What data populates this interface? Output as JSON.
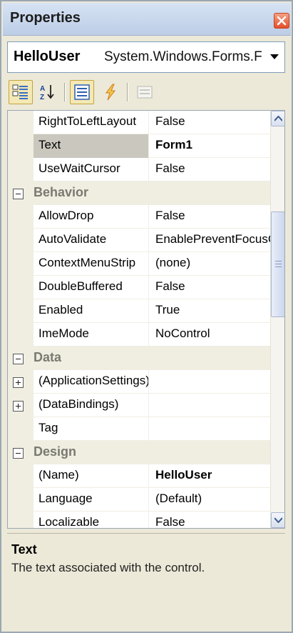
{
  "window": {
    "title": "Properties",
    "close_icon": "close-icon"
  },
  "selector": {
    "object_name": "HelloUser",
    "object_type": "System.Windows.Forms.Form"
  },
  "toolbar": {
    "buttons": [
      {
        "icon": "categorized-icon",
        "pressed": true
      },
      {
        "icon": "alphabetical-sort-icon",
        "pressed": false
      },
      {
        "icon": "properties-icon",
        "pressed": true
      },
      {
        "icon": "events-lightning-icon",
        "pressed": false
      },
      {
        "icon": "property-pages-icon",
        "pressed": false,
        "disabled": true
      }
    ]
  },
  "grid": {
    "rows": [
      {
        "kind": "prop",
        "name": "RightToLeftLayout",
        "value": "False"
      },
      {
        "kind": "prop",
        "name": "Text",
        "value": "Form1",
        "bold": true,
        "selected": true
      },
      {
        "kind": "prop",
        "name": "UseWaitCursor",
        "value": "False"
      },
      {
        "kind": "cat",
        "name": "Behavior",
        "expander": "minus"
      },
      {
        "kind": "prop",
        "name": "AllowDrop",
        "value": "False"
      },
      {
        "kind": "prop",
        "name": "AutoValidate",
        "value": "EnablePreventFocusChange"
      },
      {
        "kind": "prop",
        "name": "ContextMenuStrip",
        "value": "(none)"
      },
      {
        "kind": "prop",
        "name": "DoubleBuffered",
        "value": "False"
      },
      {
        "kind": "prop",
        "name": "Enabled",
        "value": "True"
      },
      {
        "kind": "prop",
        "name": "ImeMode",
        "value": "NoControl"
      },
      {
        "kind": "cat",
        "name": "Data",
        "expander": "minus"
      },
      {
        "kind": "prop",
        "name": "(ApplicationSettings)",
        "value": "",
        "expander": "plus"
      },
      {
        "kind": "prop",
        "name": "(DataBindings)",
        "value": "",
        "expander": "plus"
      },
      {
        "kind": "prop",
        "name": "Tag",
        "value": ""
      },
      {
        "kind": "cat",
        "name": "Design",
        "expander": "minus"
      },
      {
        "kind": "prop",
        "name": "(Name)",
        "value": "HelloUser",
        "bold": true
      },
      {
        "kind": "prop",
        "name": "Language",
        "value": "(Default)"
      },
      {
        "kind": "prop",
        "name": "Localizable",
        "value": "False"
      }
    ]
  },
  "description": {
    "title": "Text",
    "text": "The text associated with the control."
  },
  "colors": {
    "title_bar": "#c7d6ec",
    "close": "#e2502c",
    "selection": "#c9c7be",
    "category_bg": "#f0eee1"
  }
}
